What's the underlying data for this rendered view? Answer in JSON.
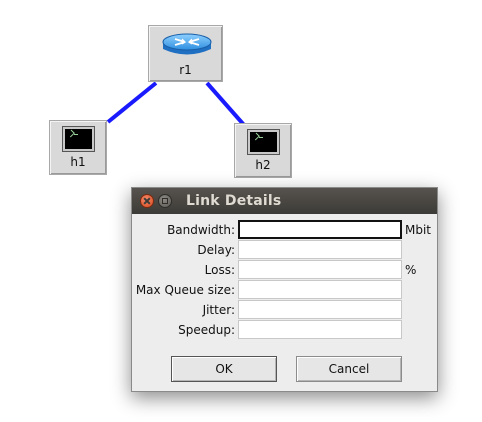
{
  "topology": {
    "nodes": [
      {
        "id": "r1",
        "label": "r1",
        "type": "router",
        "icon": "router-icon"
      },
      {
        "id": "h1",
        "label": "h1",
        "type": "host",
        "icon": "terminal-icon"
      },
      {
        "id": "h2",
        "label": "h2",
        "type": "host",
        "icon": "terminal-icon"
      }
    ],
    "links": [
      {
        "from": "r1",
        "to": "h1",
        "color": "#1a1aff"
      },
      {
        "from": "r1",
        "to": "h2",
        "color": "#1a1aff"
      }
    ]
  },
  "dialog": {
    "title": "Link Details",
    "close_icon": "close-icon",
    "minimize_icon": "minimize-icon",
    "fields": [
      {
        "label": "Bandwidth:",
        "value": "",
        "unit": "Mbit",
        "focused": true
      },
      {
        "label": "Delay:",
        "value": "",
        "unit": ""
      },
      {
        "label": "Loss:",
        "value": "",
        "unit": "%"
      },
      {
        "label": "Max Queue size:",
        "value": "",
        "unit": ""
      },
      {
        "label": "Jitter:",
        "value": "",
        "unit": ""
      },
      {
        "label": "Speedup:",
        "value": "",
        "unit": ""
      }
    ],
    "ok_label": "OK",
    "cancel_label": "Cancel"
  },
  "colors": {
    "link": "#1a1aff",
    "titlebar": "#3c3b37",
    "dialog_bg": "#ededed",
    "close_button": "#d84a1e"
  }
}
